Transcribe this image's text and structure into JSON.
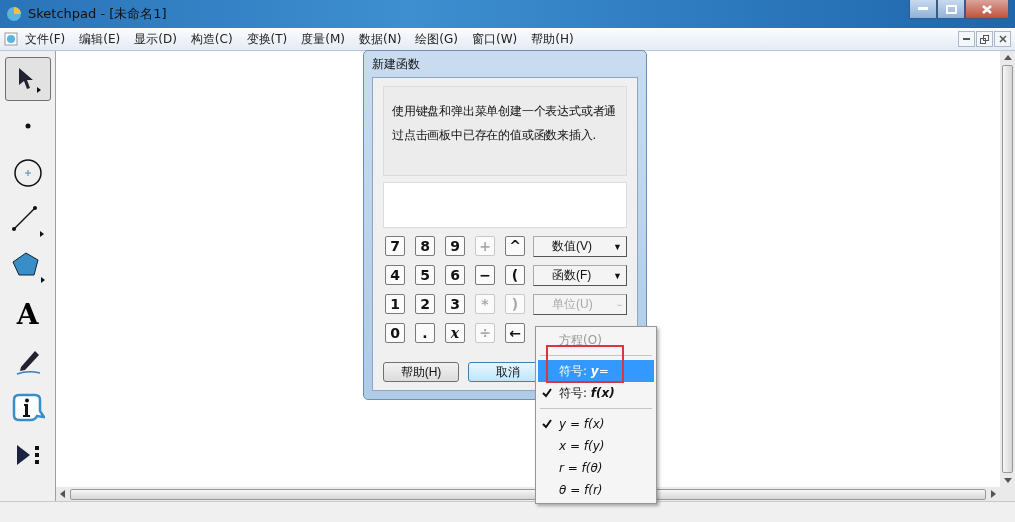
{
  "window": {
    "title": "Sketchpad  - [未命名1]"
  },
  "menu": [
    "文件(F)",
    "编辑(E)",
    "显示(D)",
    "构造(C)",
    "变换(T)",
    "度量(M)",
    "数据(N)",
    "绘图(G)",
    "窗口(W)",
    "帮助(H)"
  ],
  "tools": [
    {
      "kind": "arrow",
      "selected": true
    },
    {
      "kind": "point",
      "selected": false
    },
    {
      "kind": "compass",
      "selected": false
    },
    {
      "kind": "line",
      "selected": false
    },
    {
      "kind": "polygon",
      "selected": false
    },
    {
      "kind": "text",
      "glyph": "A",
      "selected": false
    },
    {
      "kind": "marker",
      "selected": false
    },
    {
      "kind": "info",
      "selected": false
    },
    {
      "kind": "custom",
      "selected": false
    }
  ],
  "dialog": {
    "title": "新建函数",
    "description": "使用键盘和弹出菜单创建一个表达式或者通过点击画板中已存在的值或函数来插入.",
    "keys": [
      [
        {
          "label": "7",
          "disabled": false
        },
        {
          "label": "8",
          "disabled": false
        },
        {
          "label": "9",
          "disabled": false
        },
        {
          "label": "+",
          "disabled": true
        },
        {
          "label": "^",
          "disabled": false
        }
      ],
      [
        {
          "label": "4",
          "disabled": false
        },
        {
          "label": "5",
          "disabled": false
        },
        {
          "label": "6",
          "disabled": false
        },
        {
          "label": "−",
          "disabled": false
        },
        {
          "label": "(",
          "disabled": false
        }
      ],
      [
        {
          "label": "1",
          "disabled": false
        },
        {
          "label": "2",
          "disabled": false
        },
        {
          "label": "3",
          "disabled": false
        },
        {
          "label": "*",
          "disabled": true
        },
        {
          "label": ")",
          "disabled": true
        }
      ],
      [
        {
          "label": "0",
          "disabled": false
        },
        {
          "label": ".",
          "disabled": false
        },
        {
          "label": "x",
          "disabled": false
        },
        {
          "label": "÷",
          "disabled": true
        },
        {
          "label": "←",
          "disabled": false
        }
      ]
    ],
    "dropdowns": [
      {
        "label": "数值(V)",
        "arrow": "▼",
        "disabled": false
      },
      {
        "label": "函数(F)",
        "arrow": "▼",
        "disabled": false
      },
      {
        "label": "单位(U)",
        "arrow": "−",
        "disabled": true
      }
    ],
    "buttons": [
      {
        "label": "帮助(H)",
        "default": false
      },
      {
        "label": "取消",
        "default": true
      }
    ]
  },
  "popup_menu": [
    {
      "kind": "item",
      "label": "方程(O)",
      "disabled": true,
      "checked": false,
      "selected": false
    },
    {
      "kind": "separator"
    },
    {
      "kind": "item",
      "label": "符号: **y**=",
      "disabled": false,
      "checked": false,
      "selected": true
    },
    {
      "kind": "item",
      "label": "符号: **f(x)**",
      "disabled": false,
      "checked": true,
      "selected": false
    },
    {
      "kind": "separator"
    },
    {
      "kind": "formula",
      "label": "y = f(x)",
      "disabled": false,
      "checked": true,
      "selected": false
    },
    {
      "kind": "formula",
      "label": "x = f(y)",
      "disabled": false,
      "checked": false,
      "selected": false
    },
    {
      "kind": "formula",
      "label": "r = f(θ)",
      "disabled": false,
      "checked": false,
      "selected": false
    },
    {
      "kind": "formula",
      "label": "θ = f(r)",
      "disabled": false,
      "checked": false,
      "selected": false
    }
  ]
}
